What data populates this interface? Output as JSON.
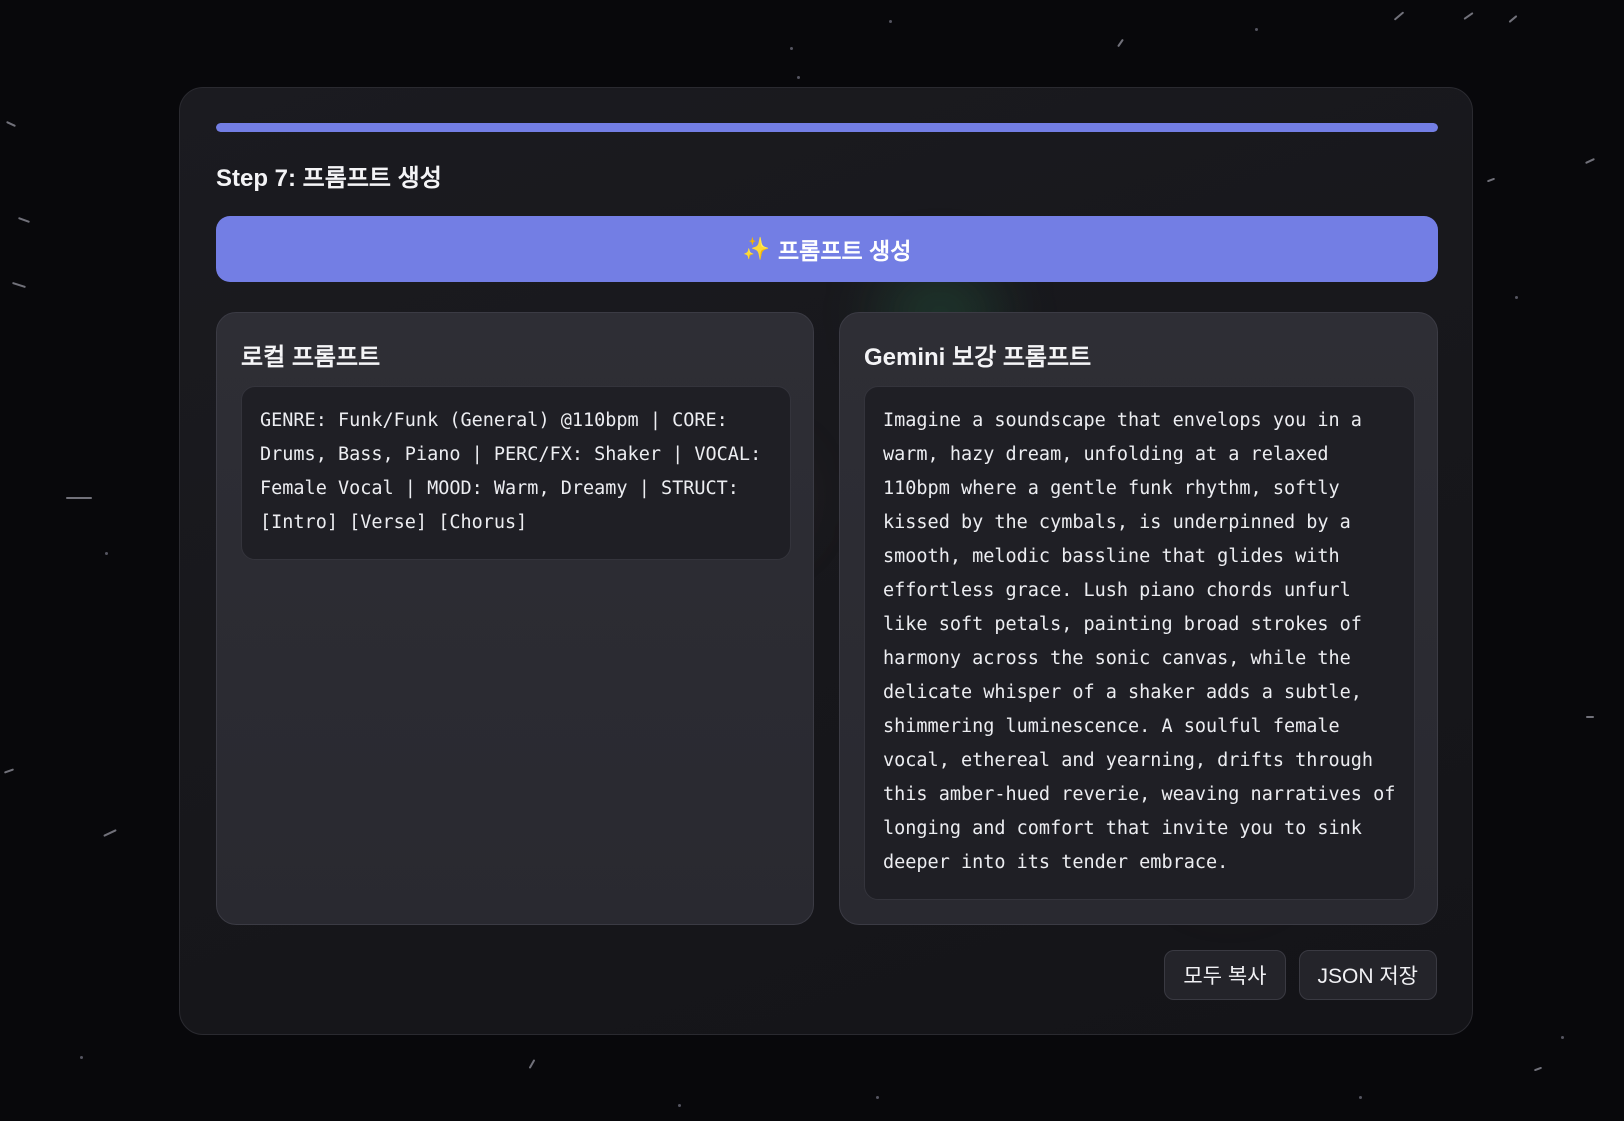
{
  "progress": {
    "fraction": 1.0
  },
  "step": {
    "title": "Step 7: 프롬프트 생성"
  },
  "generate_button": {
    "icon": "sparkles-icon",
    "icon_glyph": "✨",
    "label": "프롬프트 생성"
  },
  "local_prompt": {
    "title": "로컬 프롬프트",
    "text": "GENRE: Funk/Funk (General) @110bpm | CORE: Drums, Bass, Piano | PERC/FX: Shaker | VOCAL: Female Vocal | MOOD: Warm, Dreamy | STRUCT: [Intro] [Verse] [Chorus]"
  },
  "gemini_prompt": {
    "title": "Gemini 보강 프롬프트",
    "text": "Imagine a soundscape that envelops you in a warm, hazy dream, unfolding at a relaxed 110bpm where a gentle funk rhythm, softly kissed by the cymbals, is underpinned by a smooth, melodic bassline that glides with effortless grace. Lush piano chords unfurl like soft petals, painting broad strokes of harmony across the sonic canvas, while the delicate whisper of a shaker adds a subtle, shimmering luminescence. A soulful female vocal, ethereal and yearning, drifts through this amber-hued reverie, weaving narratives of longing and comfort that invite you to sink deeper into its tender embrace."
  },
  "actions": {
    "copy_all_label": "모두 복사",
    "save_json_label": "JSON 저장"
  },
  "colors": {
    "accent": "#737ee4",
    "background": "#08080b",
    "panel": "#1a1a1f",
    "card": "#2c2c33"
  }
}
